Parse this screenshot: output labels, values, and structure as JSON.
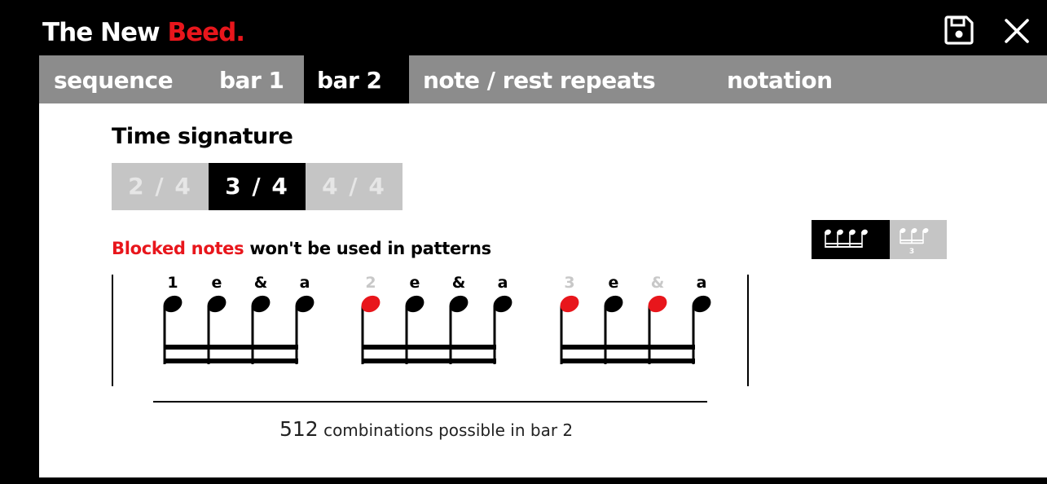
{
  "app": {
    "title_main": "The New ",
    "title_accent": "Beed."
  },
  "colors": {
    "accent": "#e8161c",
    "tabbar_bg": "#8c8c8c",
    "segment_inactive_bg": "#c5c5c5",
    "segment_inactive_text": "#e6e6e6",
    "blocked_note": "#e8161c",
    "disabled_beat_label": "#c8c8c8"
  },
  "icons": {
    "save": "floppy-disk-icon",
    "close": "close-x-icon",
    "sixteenths": "four-sixteenth-notes-icon",
    "triplets": "triplet-notes-icon"
  },
  "tabs": [
    {
      "label": "sequence",
      "active": false
    },
    {
      "label": "bar 1",
      "active": false
    },
    {
      "label": "bar 2",
      "active": true
    },
    {
      "label": "note / rest repeats",
      "active": false
    },
    {
      "label": "notation",
      "active": false
    }
  ],
  "time_signature": {
    "label": "Time signature",
    "options": [
      {
        "label": "2 / 4",
        "selected": false
      },
      {
        "label": "3 / 4",
        "selected": true
      },
      {
        "label": "4 / 4",
        "selected": false
      }
    ]
  },
  "blocked_hint": {
    "highlight": "Blocked notes",
    "rest": " won't be used in patterns"
  },
  "subdivision_mode": {
    "options": [
      {
        "name": "sixteenths",
        "selected": true
      },
      {
        "name": "triplets",
        "selected": false,
        "label": "3"
      }
    ]
  },
  "beats": [
    {
      "notes": [
        {
          "label": "1",
          "blocked": false
        },
        {
          "label": "e",
          "blocked": false
        },
        {
          "label": "&",
          "blocked": false
        },
        {
          "label": "a",
          "blocked": false
        }
      ]
    },
    {
      "notes": [
        {
          "label": "2",
          "blocked": true
        },
        {
          "label": "e",
          "blocked": false
        },
        {
          "label": "&",
          "blocked": false
        },
        {
          "label": "a",
          "blocked": false
        }
      ]
    },
    {
      "notes": [
        {
          "label": "3",
          "blocked": true
        },
        {
          "label": "e",
          "blocked": false
        },
        {
          "label": "&",
          "blocked": true
        },
        {
          "label": "a",
          "blocked": false
        }
      ]
    }
  ],
  "combinations": {
    "count": "512",
    "text": " combinations possible in bar 2"
  }
}
